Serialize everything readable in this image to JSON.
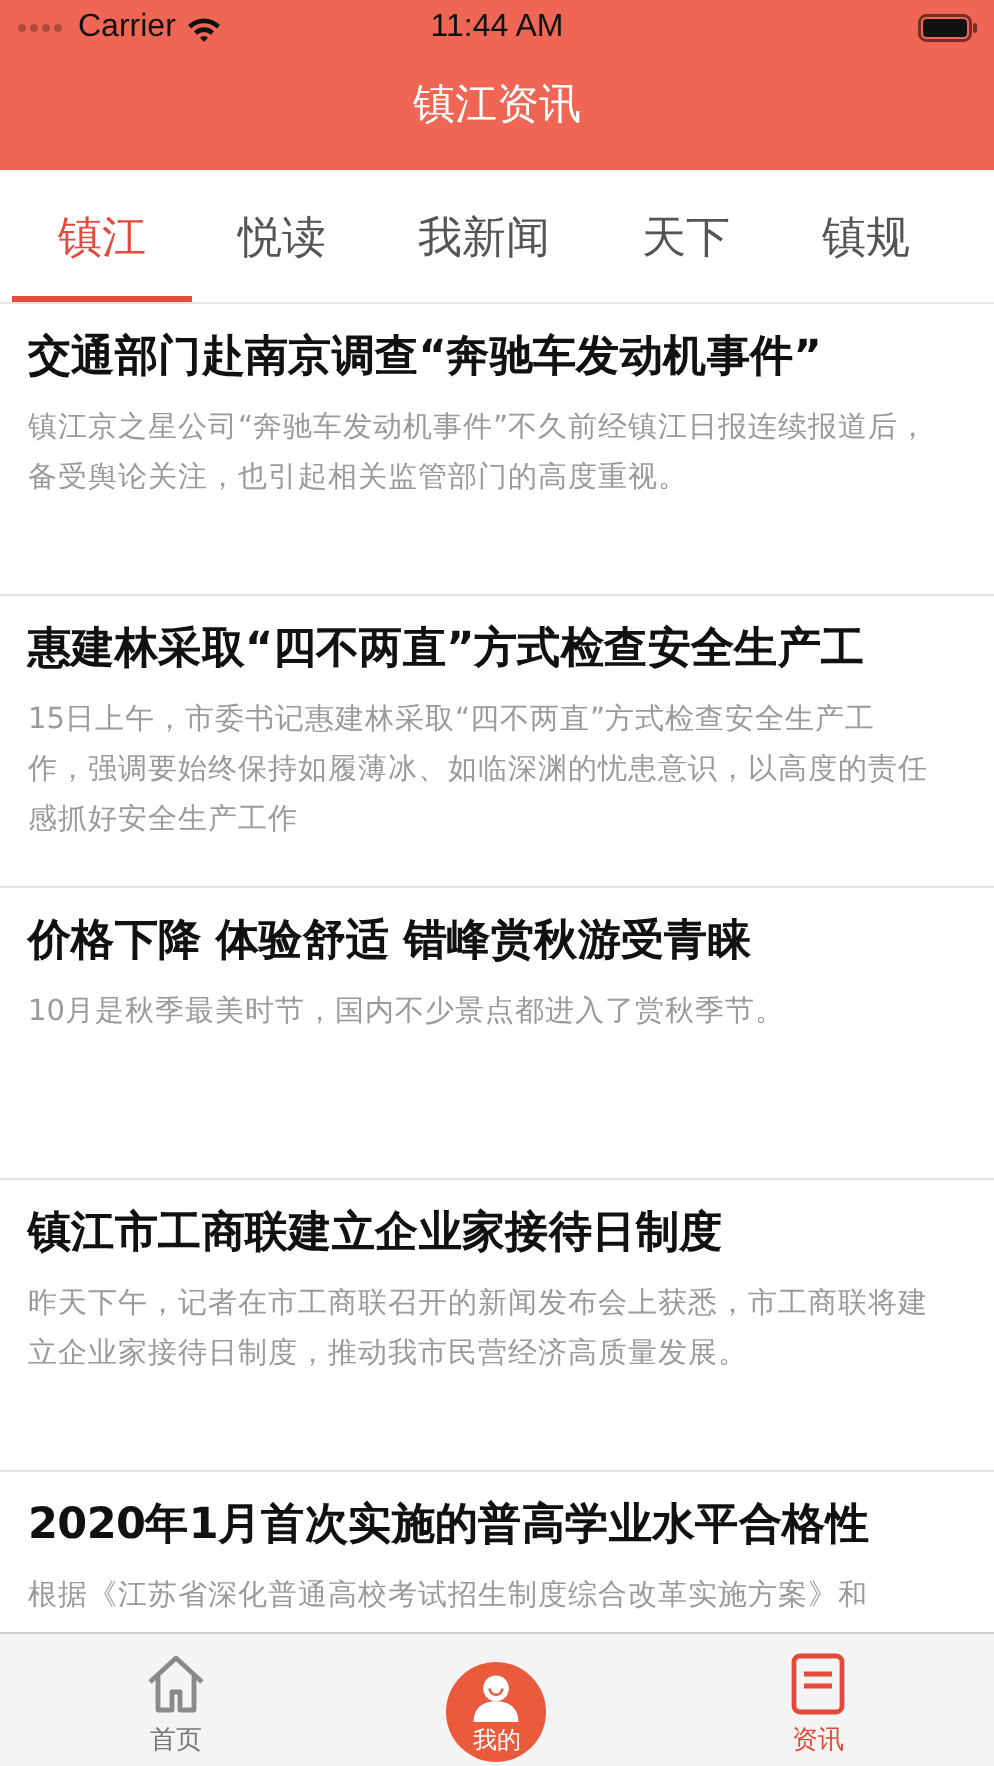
{
  "status_bar": {
    "carrier": "Carrier",
    "time": "11:44 AM"
  },
  "nav_bar": {
    "title": "镇江资讯"
  },
  "tabs": [
    {
      "label": "镇江",
      "selected": true
    },
    {
      "label": "悦读",
      "selected": false
    },
    {
      "label": "我新闻",
      "selected": false
    },
    {
      "label": "天下",
      "selected": false
    },
    {
      "label": "镇规",
      "selected": false
    }
  ],
  "articles": [
    {
      "title": "交通部门赴南京调查“奔驰车发动机事件”",
      "summary": "镇江京之星公司“奔驰车发动机事件”不久前经镇江日报连续报道后，备受舆论关注，也引起相关监管部门的高度重视。"
    },
    {
      "title": "惠建林采取“四不两直”方式检查安全生产工",
      "summary": "15日上午，市委书记惠建林采取“四不两直”方式检查安全生产工作，强调要始终保持如履薄冰、如临深渊的忧患意识，以高度的责任感抓好安全生产工作"
    },
    {
      "title": "价格下降 体验舒适 错峰赏秋游受青睐",
      "summary": "10月是秋季最美时节，国内不少景点都进入了赏秋季节。"
    },
    {
      "title": "镇江市工商联建立企业家接待日制度",
      "summary": "昨天下午，记者在市工商联召开的新闻发布会上获悉，市工商联将建立企业家接待日制度，推动我市民营经济高质量发展。"
    },
    {
      "title": "2020年1月首次实施的普高学业水平合格性",
      "summary": "根据《江苏省深化普通高校考试招生制度综合改革实施方案》和"
    }
  ],
  "tab_bar": [
    {
      "kind": "home",
      "label": "首页",
      "selected": false
    },
    {
      "kind": "profile",
      "label": "我的",
      "selected": false
    },
    {
      "kind": "news",
      "label": "资讯",
      "selected": true
    }
  ]
}
